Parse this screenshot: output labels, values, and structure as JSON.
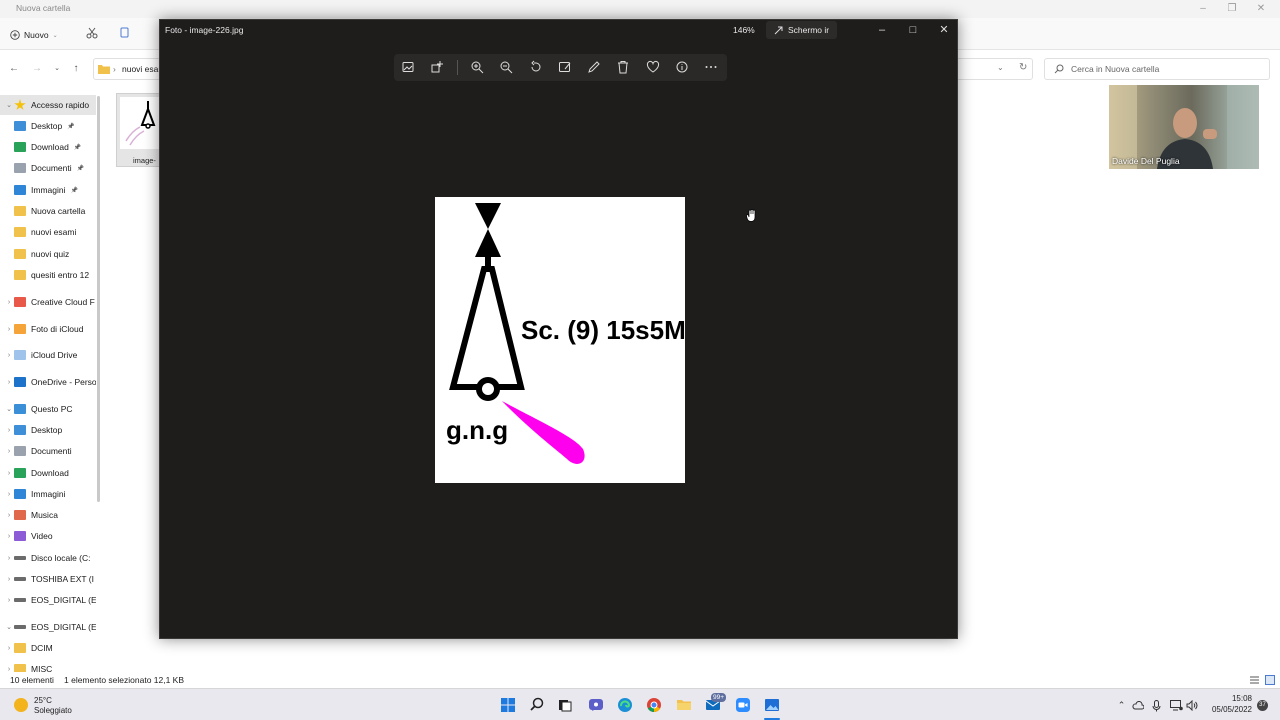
{
  "explorer": {
    "title": "Nuova cartella",
    "new_label": "Nuovo",
    "address": "nuovi esam",
    "search_placeholder": "Cerca in Nuova cartella",
    "sidebar": [
      {
        "label": "Accesso rapido",
        "icon": "star-icon"
      },
      {
        "label": "Desktop",
        "icon": "desktop-icon"
      },
      {
        "label": "Download",
        "icon": "download-icon"
      },
      {
        "label": "Documenti",
        "icon": "documents-icon"
      },
      {
        "label": "Immagini",
        "icon": "pictures-icon"
      },
      {
        "label": "Nuova cartella",
        "icon": "folder-icon"
      },
      {
        "label": "nuovi esami",
        "icon": "folder-icon"
      },
      {
        "label": "nuovi quiz",
        "icon": "folder-icon"
      },
      {
        "label": "quesiti entro 12",
        "icon": "folder-icon"
      },
      {
        "label": "Creative Cloud F",
        "icon": "creative-cloud-icon"
      },
      {
        "label": "Foto di iCloud",
        "icon": "icloud-photos-icon"
      },
      {
        "label": "iCloud Drive",
        "icon": "icloud-icon"
      },
      {
        "label": "OneDrive - Perso",
        "icon": "onedrive-icon"
      },
      {
        "label": "Questo PC",
        "icon": "pc-icon"
      },
      {
        "label": "Desktop",
        "icon": "desktop-icon"
      },
      {
        "label": "Documenti",
        "icon": "documents-icon"
      },
      {
        "label": "Download",
        "icon": "download-icon"
      },
      {
        "label": "Immagini",
        "icon": "pictures-icon"
      },
      {
        "label": "Musica",
        "icon": "music-icon"
      },
      {
        "label": "Video",
        "icon": "video-icon"
      },
      {
        "label": "Disco locale (C:",
        "icon": "drive-icon"
      },
      {
        "label": "TOSHIBA EXT (I",
        "icon": "drive-icon"
      },
      {
        "label": "EOS_DIGITAL (E",
        "icon": "drive-icon"
      },
      {
        "label": "EOS_DIGITAL (E:)",
        "icon": "drive-icon"
      },
      {
        "label": "DCIM",
        "icon": "folder-icon"
      },
      {
        "label": "MISC",
        "icon": "folder-icon"
      }
    ],
    "file_label": "image-",
    "status_count": "10 elementi",
    "status_selection": "1 elemento selezionato 12,1 KB"
  },
  "webcam": {
    "name": "Davide Del Puglia"
  },
  "viewer": {
    "title": "Foto - image-226.jpg",
    "zoom": "146%",
    "fullscreen_label": "Schermo ir",
    "photo_text": {
      "light": "Sc. (9) 15s5M",
      "colour": "g.n.g"
    },
    "colors": {
      "magenta_light": "#ff00ee"
    }
  },
  "taskbar": {
    "weather_temp": "25°C",
    "weather_condition": "Soleggiato",
    "mail_badge": "99+",
    "time": "15:08",
    "date": "05/05/2022",
    "notifications": "37"
  }
}
